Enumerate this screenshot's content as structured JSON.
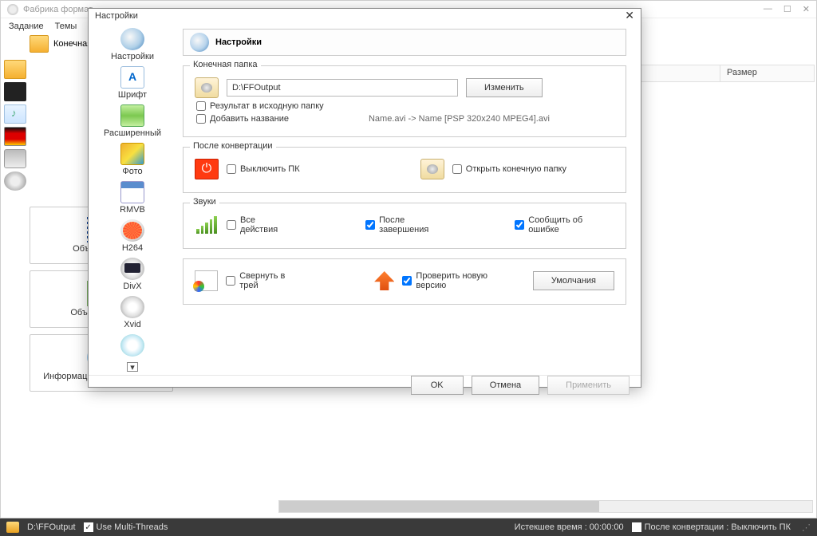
{
  "app": {
    "title": "Фабрика формат"
  },
  "menu": [
    "Задание",
    "Темы"
  ],
  "top_folder_label": "Конечная па",
  "columns": {
    "size": "Размер"
  },
  "actions": {
    "join_video": "Объединить в",
    "join_audio": "Объединить ау",
    "media_info": "Информация о медиафайле"
  },
  "categories": [
    "Настройки",
    "Шрифт",
    "Расширенный",
    "Фото",
    "RMVB",
    "H264",
    "DivX",
    "Xvid"
  ],
  "modal": {
    "title": "Настройки",
    "header": "Настройки",
    "group_output": {
      "title": "Конечная папка",
      "path": "D:\\FFOutput",
      "change": "Изменить",
      "to_source": "Результат в исходную папку",
      "add_name": "Добавить название",
      "name_example": "Name.avi  -> Name [PSP 320x240 MPEG4].avi"
    },
    "group_after": {
      "title": "После конвертации",
      "shutdown": "Выключить ПК",
      "open_folder": "Открыть конечную папку"
    },
    "group_sounds": {
      "title": "Звуки",
      "all": "Все действия",
      "after_done": "После завершения",
      "on_error": "Сообщить об ошибке"
    },
    "misc": {
      "to_tray": "Свернуть в трей",
      "check_update": "Проверить новую версию",
      "defaults": "Умолчания"
    },
    "buttons": {
      "ok": "OK",
      "cancel": "Отмена",
      "apply": "Применить"
    }
  },
  "statusbar": {
    "output": "D:\\FFOutput",
    "multithread": "Use Multi-Threads",
    "elapsed": "Истекшее время : 00:00:00",
    "after": "После конвертации : Выключить ПК"
  }
}
